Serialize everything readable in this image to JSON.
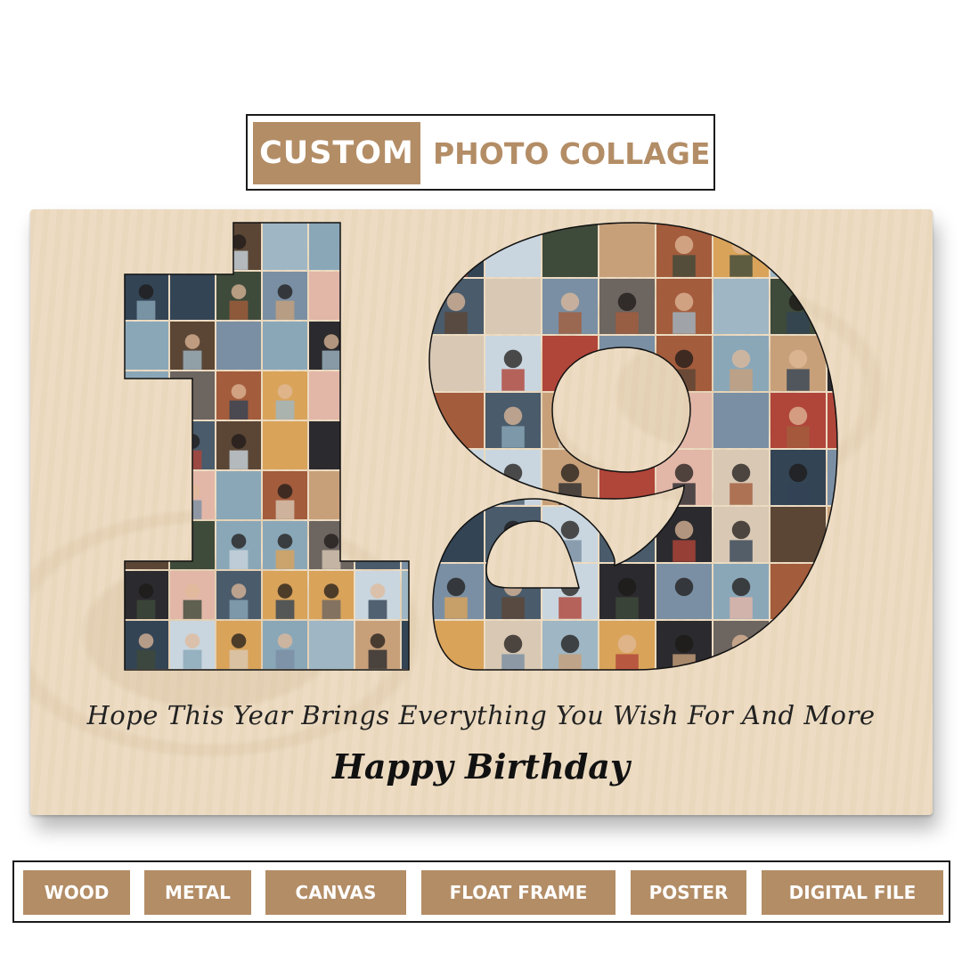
{
  "header": {
    "badge": "CUSTOM",
    "title": "PHOTO COLLAGE"
  },
  "collage": {
    "number": "19",
    "wish_text": "Hope This Year Brings Everything You Wish For And More",
    "greeting": "Happy Birthday"
  },
  "options": [
    "WOOD",
    "METAL",
    "CANVAS",
    "FLOAT FRAME",
    "POSTER",
    "DIGITAL FILE"
  ],
  "colors": {
    "accent": "#b38d66",
    "wood": "#ecdbc1",
    "text": "#222222"
  }
}
